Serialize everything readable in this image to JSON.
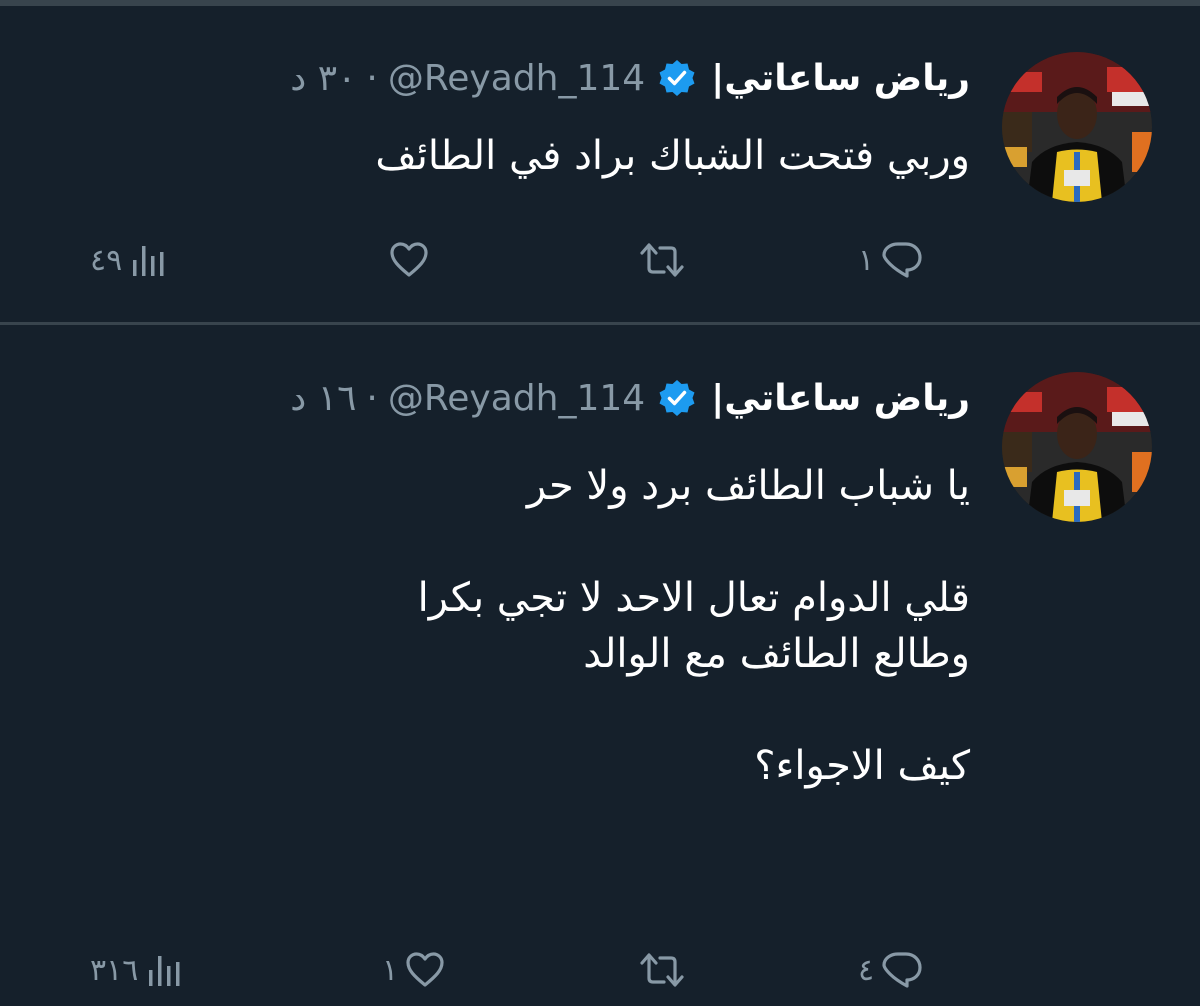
{
  "tweets": [
    {
      "display_name": "رياض ساعاتي|",
      "handle": "@Reyadh_114",
      "separator": "·",
      "time": "٣٠ د",
      "text_lines": [
        "وربي فتحت الشباك براد في الطائف"
      ],
      "stats": {
        "views": "٤٩",
        "likes": "",
        "retweets": "",
        "replies": "١"
      }
    },
    {
      "display_name": "رياض ساعاتي|",
      "handle": "@Reyadh_114",
      "separator": "·",
      "time": "١٦ د",
      "text_lines": [
        "يا شباب الطائف برد ولا حر",
        "",
        "قلي الدوام تعال الاحد لا تجي بكرا",
        "وطالع الطائف مع الوالد",
        "",
        "كيف الاجواء؟"
      ],
      "stats": {
        "views": "٣١٦",
        "likes": "١",
        "retweets": "",
        "replies": "٤"
      }
    }
  ],
  "icons": {
    "verified": "verified-badge-icon",
    "views": "views-bar-chart-icon",
    "like": "heart-icon",
    "retweet": "retweet-icon",
    "reply": "reply-bubble-icon"
  },
  "colors": {
    "background": "#15202b",
    "divider": "#38444d",
    "text_primary": "#ffffff",
    "text_secondary": "#8899a6",
    "verified_blue": "#1d9bf0"
  }
}
